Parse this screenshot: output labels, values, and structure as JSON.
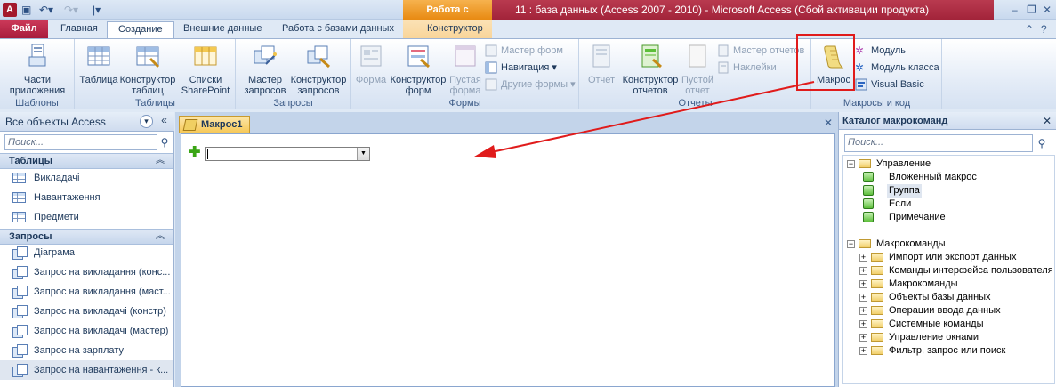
{
  "window": {
    "title": "11 : база данных (Access 2007 - 2010)  -  Microsoft Access (Сбой активации продукта)",
    "context_tab": "Работа с макросами",
    "app_icon_letter": "A"
  },
  "ribbon_tabs": [
    "Файл",
    "Главная",
    "Создание",
    "Внешние данные",
    "Работа с базами данных",
    "Конструктор"
  ],
  "groups": {
    "templates": {
      "label": "Шаблоны",
      "parts": "Части\nприложения"
    },
    "tables": {
      "label": "Таблицы",
      "table": "Таблица",
      "designer": "Конструктор\nтаблиц",
      "sharepoint": "Списки\nSharePoint"
    },
    "queries": {
      "label": "Запросы",
      "wizard": "Мастер\nзапросов",
      "designer": "Конструктор\nзапросов"
    },
    "forms": {
      "label": "Формы",
      "form": "Форма",
      "designer": "Конструктор\nформ",
      "blank": "Пустая\nформа",
      "wizard": "Мастер форм",
      "navigation": "Навигация",
      "other": "Другие формы"
    },
    "reports": {
      "label": "Отчеты",
      "report": "Отчет",
      "designer": "Конструктор\nотчетов",
      "blank": "Пустой\nотчет",
      "wizard": "Мастер отчетов",
      "labels": "Наклейки"
    },
    "macros": {
      "label": "Макросы и код",
      "macro": "Макрос",
      "module": "Модуль",
      "class_module": "Модуль класса",
      "vb": "Visual Basic"
    }
  },
  "nav_pane": {
    "title": "Все объекты Access",
    "search_placeholder": "Поиск...",
    "sections": [
      {
        "label": "Таблицы",
        "items": [
          "Викладачі",
          "Навантаження",
          "Предмети"
        ]
      },
      {
        "label": "Запросы",
        "items": [
          "Діаграма",
          "Запрос на викладання (конс...",
          "Запрос на викладання (маст...",
          "Запрос на викладачі (констр)",
          "Запрос на викладачі (мастер)",
          "Запрос на зарплату",
          "Запрос на навантаження - к..."
        ]
      }
    ]
  },
  "document": {
    "tab_label": "Макрос1",
    "add_action_value": ""
  },
  "catalog": {
    "title": "Каталог макрокоманд",
    "search_placeholder": "Поиск...",
    "control": {
      "label": "Управление",
      "items": [
        "Вложенный макрос",
        "Группа",
        "Если",
        "Примечание"
      ]
    },
    "actions": {
      "label": "Макрокоманды",
      "items": [
        "Импорт или экспорт данных",
        "Команды интерфейса пользователя",
        "Макрокоманды",
        "Объекты базы данных",
        "Операции ввода данных",
        "Системные команды",
        "Управление окнами",
        "Фильтр, запрос или поиск"
      ]
    }
  },
  "colors": {
    "accent": "#a81c3c",
    "context": "#e88a12",
    "highlight": "#e01b1b",
    "arrow": "#e01b1b"
  }
}
